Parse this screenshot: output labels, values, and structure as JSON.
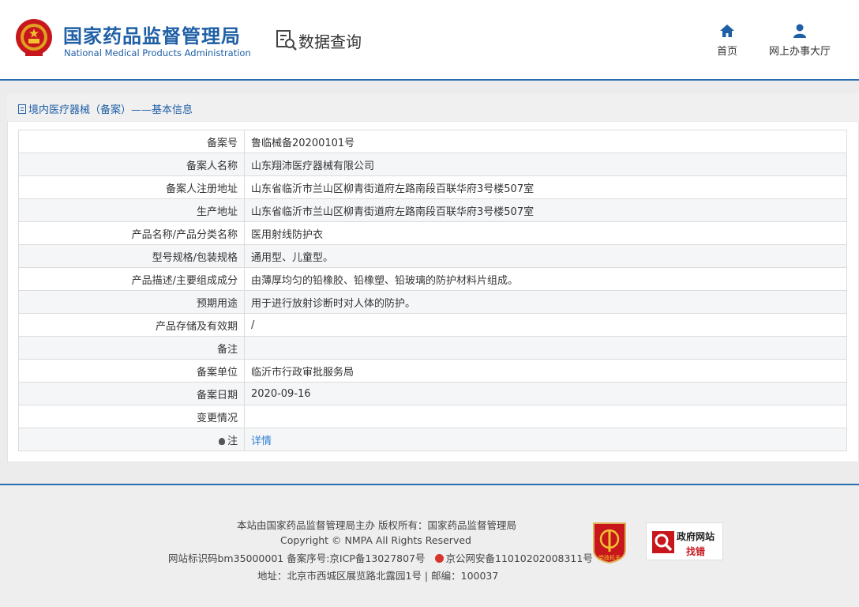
{
  "header": {
    "org_name_cn": "国家药品监督管理局",
    "org_name_en": "National Medical Products Administration",
    "page_title": "数据查询",
    "nav": [
      {
        "label": "首页",
        "icon": "home-icon"
      },
      {
        "label": "网上办事大厅",
        "icon": "user-icon"
      }
    ]
  },
  "panel": {
    "title": "境内医疗器械（备案）——基本信息"
  },
  "record": {
    "rows": [
      {
        "label": "备案号",
        "value": "鲁临械备20200101号"
      },
      {
        "label": "备案人名称",
        "value": "山东翔沛医疗器械有限公司"
      },
      {
        "label": "备案人注册地址",
        "value": "山东省临沂市兰山区柳青街道府左路南段百联华府3号楼507室"
      },
      {
        "label": "生产地址",
        "value": "山东省临沂市兰山区柳青街道府左路南段百联华府3号楼507室"
      },
      {
        "label": "产品名称/产品分类名称",
        "value": "医用射线防护衣"
      },
      {
        "label": "型号规格/包装规格",
        "value": "通用型、儿童型。"
      },
      {
        "label": "产品描述/主要组成成分",
        "value": "由薄厚均匀的铅橡胶、铅橡塑、铅玻璃的防护材料片组成。"
      },
      {
        "label": "预期用途",
        "value": "用于进行放射诊断时对人体的防护。"
      },
      {
        "label": "产品存储及有效期",
        "value": "/"
      },
      {
        "label": "备注",
        "value": ""
      },
      {
        "label": "备案单位",
        "value": "临沂市行政审批服务局"
      },
      {
        "label": "备案日期",
        "value": "2020-09-16"
      },
      {
        "label": "变更情况",
        "value": ""
      }
    ],
    "note_label": "注",
    "note_link": "详情"
  },
  "footer": {
    "line1": "本站由国家药品监督管理局主办 版权所有：国家药品监督管理局",
    "line2": "Copyright © NMPA All Rights Reserved",
    "site_id": "网站标识码bm35000001",
    "icp": "备案序号:京ICP备13027807号",
    "police": "京公网安备11010202008311号",
    "address": "地址：北京市西城区展览路北露园1号 | 邮编：100037",
    "badge_red_text": "党政机关",
    "gov_badge_line1": "政府网站",
    "gov_badge_line2": "找错"
  },
  "colors": {
    "brand_blue": "#1f5fa6",
    "link_blue": "#2f7fd0",
    "badge_red": "#c8161d"
  }
}
